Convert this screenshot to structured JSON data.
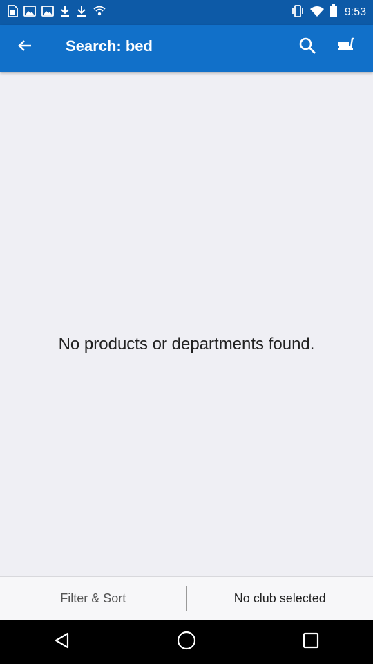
{
  "status_bar": {
    "time": "9:53",
    "left_icons": [
      "sim-card-icon",
      "photo-icon",
      "photo-icon",
      "download-icon",
      "download-icon",
      "wifi-hotspot-icon"
    ],
    "right_icons": [
      "vibrate-icon",
      "wifi-icon",
      "battery-icon"
    ]
  },
  "app_bar": {
    "title": "Search: bed",
    "back_icon": "back-arrow-icon",
    "search_icon": "search-icon",
    "cart_icon": "cart-icon",
    "color": "#1170c9"
  },
  "main": {
    "empty_message": "No products or departments found."
  },
  "bottom_bar": {
    "filter_label": "Filter & Sort",
    "club_label": "No club selected"
  },
  "nav_bar": {
    "icons": [
      "back-triangle-icon",
      "home-circle-icon",
      "recents-square-icon"
    ]
  }
}
